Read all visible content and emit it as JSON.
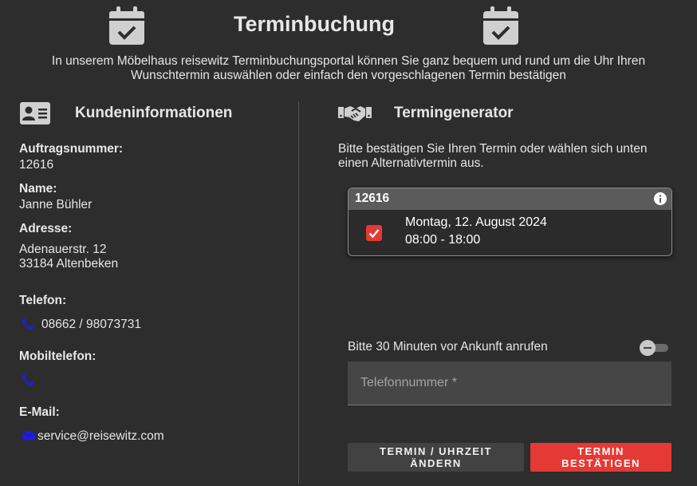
{
  "header": {
    "title": "Terminbuchung",
    "intro": "In unserem Möbelhaus reisewitz Terminbuchungsportal können Sie ganz bequem und rund um die Uhr Ihren Wunschtermin auswählen oder einfach den vorgeschlagenen Termin bestätigen",
    "icon_left": "calendar-check-icon",
    "icon_right": "calendar-check-icon"
  },
  "customer": {
    "section_title": "Kundeninformationen",
    "section_icon": "id-card-icon",
    "order_label": "Auftragsnummer:",
    "order_value": "12616",
    "name_label": "Name:",
    "name_value": "Janne Bühler",
    "address_label": "Adresse:",
    "address_line1": "Adenauerstr. 12",
    "address_line2": "33184 Altenbeken",
    "phone_label": "Telefon:",
    "phone_value": "08662 / 98073731",
    "mobile_label": "Mobiltelefon:",
    "mobile_value": "",
    "email_label": "E-Mail:",
    "email_value": "service@reisewitz.com"
  },
  "generator": {
    "section_title": "Termingenerator",
    "section_icon": "handshake-icon",
    "intro": "Bitte bestätigen Sie Ihren Termin oder wählen sich unten einen Alternativtermin aus.",
    "card": {
      "id": "12616",
      "info_icon": "info-icon",
      "date": "Montag, 12. August 2024",
      "time": "08:00 - 18:00",
      "checked": true
    },
    "call_label": "Bitte 30 Minuten vor Ankunft anrufen",
    "call_toggle_on": false,
    "phone_placeholder": "Telefonnummer *",
    "phone_value": "",
    "btn_change": "TERMIN / UHRZEIT ÄNDERN",
    "btn_confirm": "TERMIN BESTÄTIGEN"
  },
  "colors": {
    "background": "#2d2d2d",
    "accent_red": "#e53935",
    "icon_blue": "#1a1aff",
    "icon_gray": "#d0d0d0"
  }
}
